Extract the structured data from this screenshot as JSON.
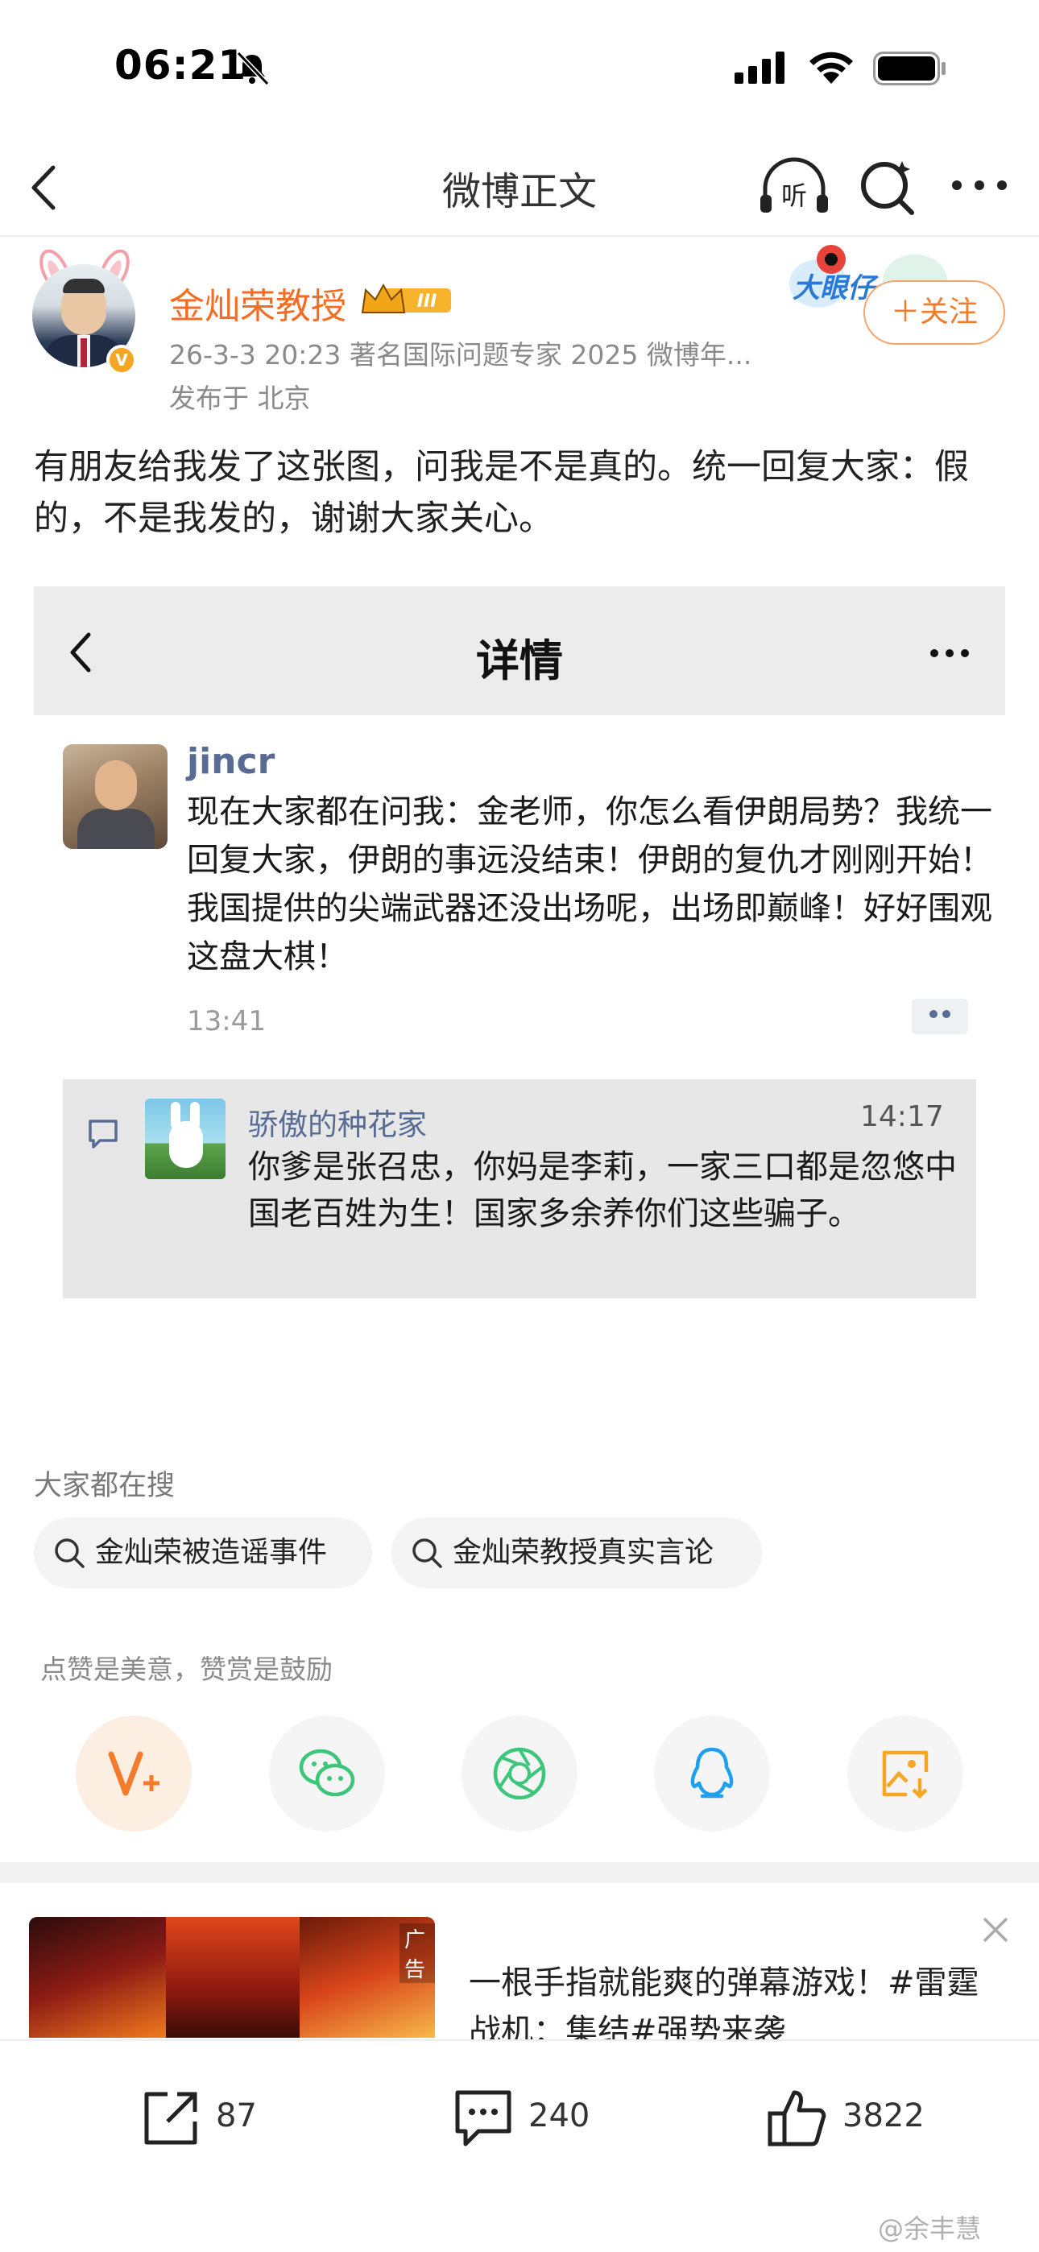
{
  "status_bar": {
    "time": "06:21"
  },
  "nav": {
    "title": "微博正文",
    "listen_label": "听"
  },
  "post": {
    "author": "金灿荣教授",
    "level_badge": "III",
    "meta": "26-3-3 20:23  著名国际问题专家 2025 微博年...",
    "location": "发布于 北京",
    "follow_label": "＋关注",
    "sticker_text": "大眼仔",
    "text": "有朋友给我发了这张图，问我是不是真的。统一回复大家：假的，不是我发的，谢谢大家关心。"
  },
  "embedded_screenshot": {
    "title": "详情",
    "user": "jincr",
    "body": "现在大家都在问我：金老师，你怎么看伊朗局势？我统一回复大家，伊朗的事远没结束！伊朗的复仇才刚刚开始！我国提供的尖端武器还没出场呢，出场即巅峰！好好围观这盘大棋！",
    "time": "13:41",
    "reply": {
      "name": "骄傲的种花家",
      "time": "14:17",
      "text": "你爹是张召忠，你妈是李莉，一家三口都是忽悠中国老百姓为生！国家多余养你们这些骗子。"
    }
  },
  "searches": {
    "title": "大家都在搜",
    "items": [
      "金灿荣被造谣事件",
      "金灿荣教授真实言论"
    ]
  },
  "reward": {
    "text": "点赞是美意，赞赏是鼓励"
  },
  "share_icons": [
    "reward-icon",
    "wechat-icon",
    "moments-icon",
    "qq-icon",
    "save-image-icon"
  ],
  "ad": {
    "tag": "广告",
    "text": "一根手指就能爽的弹幕游戏！#雷霆战机：集结#强势来袭"
  },
  "bottom_bar": {
    "reposts": "87",
    "comments": "240",
    "likes": "3822"
  },
  "watermark": "@余丰慧",
  "colors": {
    "accent_orange": "#f56c24",
    "link_blue": "#576b95",
    "wechat_green": "#3cc67a",
    "qq_blue": "#1ea0f0"
  }
}
